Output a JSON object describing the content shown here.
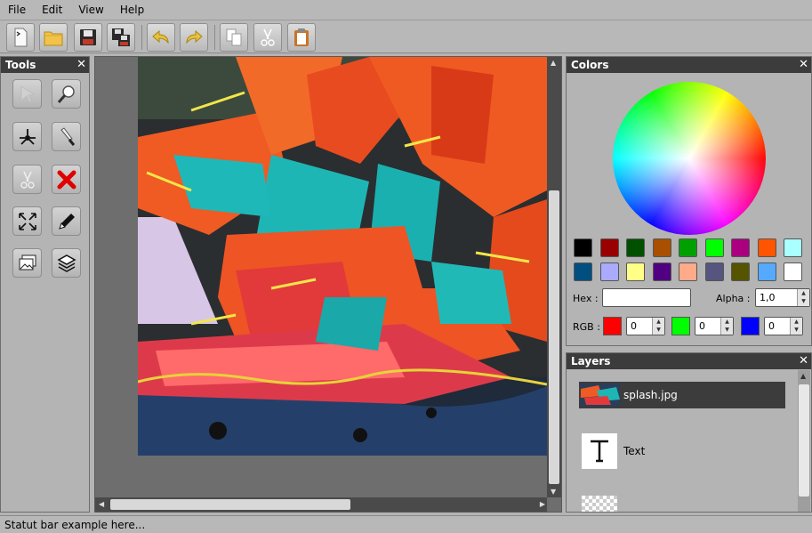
{
  "menu": {
    "file": "File",
    "edit": "Edit",
    "view": "View",
    "help": "Help"
  },
  "toolbar": {
    "buttons": [
      "new-file-icon",
      "open-folder-icon",
      "save-icon",
      "save-all-icon",
      "undo-icon",
      "redo-icon",
      "copy-icon",
      "cut-icon",
      "paste-icon"
    ]
  },
  "tools": {
    "title": "Tools",
    "close": "✕",
    "items": [
      "select-icon",
      "zoom-icon",
      "move-icon",
      "knife-icon",
      "cut-icon",
      "delete-icon",
      "fullscreen-icon",
      "pencil-icon",
      "images-icon",
      "layers-icon"
    ]
  },
  "colors": {
    "title": "Colors",
    "close": "✕",
    "swatches": [
      "#000000",
      "#990000",
      "#005000",
      "#a95000",
      "#00a000",
      "#00ff00",
      "#aa0080",
      "#ff5500",
      "#aaffff",
      "#004f80",
      "#aaaaff",
      "#ffff88",
      "#500080",
      "#ffaa88",
      "#555580",
      "#555500",
      "#55aaff",
      "#ffffff"
    ],
    "hex_label": "Hex :",
    "hex_value": "",
    "alpha_label": "Alpha :",
    "alpha_value": "1,0",
    "rgb_label": "RGB :",
    "red": {
      "color": "#ff0000",
      "value": "0"
    },
    "green": {
      "color": "#00ff00",
      "value": "0"
    },
    "blue": {
      "color": "#0000ff",
      "value": "0"
    }
  },
  "layers": {
    "title": "Layers",
    "close": "✕",
    "items": [
      {
        "name": "splash.jpg",
        "selected": true
      },
      {
        "name": "Text",
        "selected": false
      },
      {
        "name": "",
        "selected": false
      }
    ]
  },
  "status": {
    "text": "Statut bar example here..."
  }
}
